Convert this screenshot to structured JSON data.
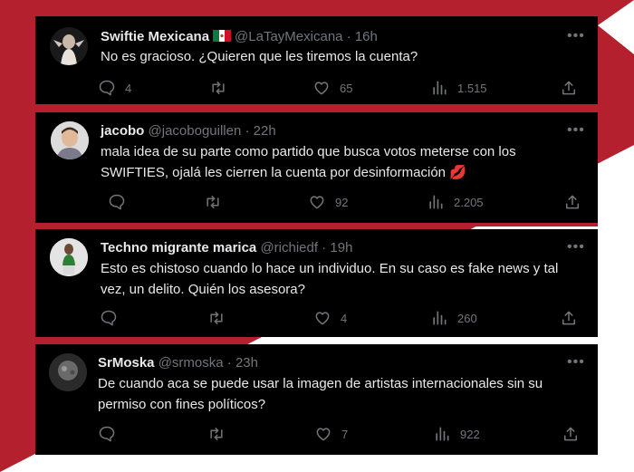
{
  "tweets": [
    {
      "name": "Swiftie Mexicana",
      "flag": "mexico-flag",
      "handle": "@LaTayMexicana",
      "time": "16h",
      "text": "No es gracioso. ¿Quieren que les tiremos la cuenta?",
      "replies": "4",
      "retweets": "",
      "likes": "65",
      "views": "1.515"
    },
    {
      "name": "jacobo",
      "handle": "@jacoboguillen",
      "time": "22h",
      "text_line1": "mala idea de su parte como partido que busca votos meterse con los",
      "text_line2": "SWIFTIES, ojalá les cierren la cuenta por desinformación 💋",
      "replies": "",
      "retweets": "",
      "likes": "92",
      "views": "2.205"
    },
    {
      "name": "Techno migrante marica",
      "handle": "@richiedf",
      "time": "19h",
      "text_line1": "Esto es chistoso cuando lo hace un individuo. En su caso es fake news y tal",
      "text_line2": "vez, un delito. Quién los asesora?",
      "replies": "",
      "retweets": "",
      "likes": "4",
      "views": "260"
    },
    {
      "name": "SrMoska",
      "handle": "@srmoska",
      "time": "23h",
      "text_line1": "De cuando aca se puede usar la imagen de artistas internacionales sin su",
      "text_line2": "permiso con fines políticos?",
      "replies": "",
      "retweets": "",
      "likes": "7",
      "views": "922"
    }
  ],
  "colors": {
    "background_red": "#b5202e",
    "card": "#000000",
    "text": "#e7e9ea",
    "muted": "#71767b"
  },
  "icons": [
    "reply-icon",
    "retweet-icon",
    "like-icon",
    "views-icon",
    "share-icon",
    "more-icon"
  ]
}
